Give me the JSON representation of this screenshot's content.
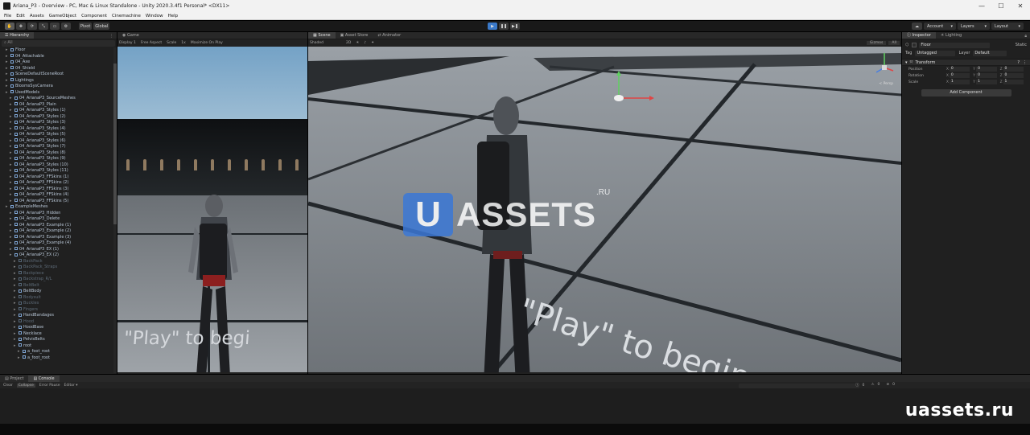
{
  "window": {
    "title": "Ariana_P3 - Overview - PC, Mac & Linux Standalone - Unity 2020.3.4f1 Personal* <DX11>",
    "controls": [
      "—",
      "☐",
      "✕"
    ]
  },
  "menu": [
    "File",
    "Edit",
    "Assets",
    "GameObject",
    "Component",
    "Cinemachine",
    "Window",
    "Help"
  ],
  "toolbar": {
    "tools": [
      "✋",
      "✥",
      "⟳",
      "⤡",
      "▭",
      "⚙"
    ],
    "pivot": "Pivot",
    "global": "Global",
    "play": "▶",
    "pause": "❚❚",
    "step": "▶❚",
    "account": "Account",
    "layers": "Layers",
    "layout": "Layout"
  },
  "hierarchy": {
    "tab": "Hierarchy",
    "search_placeholder": "All",
    "items": [
      {
        "label": "Floor",
        "indent": 1,
        "dim": false
      },
      {
        "label": "04_Attachable",
        "indent": 1,
        "dim": false
      },
      {
        "label": "04_Axe",
        "indent": 1,
        "dim": false
      },
      {
        "label": "04_Shield",
        "indent": 1,
        "dim": false
      },
      {
        "label": "SceneDefaultSceneRoot",
        "indent": 1,
        "dim": false
      },
      {
        "label": "Lightings",
        "indent": 1,
        "dim": false
      },
      {
        "label": "BloomsSysCamera",
        "indent": 1,
        "dim": false
      },
      {
        "label": "UsedModels",
        "indent": 1,
        "dim": false
      },
      {
        "label": "04_ArianaP3_SourceMeshes",
        "indent": 2,
        "dim": false
      },
      {
        "label": "04_ArianaP3_Plain",
        "indent": 2,
        "dim": false
      },
      {
        "label": "04_ArianaP3_Styles (1)",
        "indent": 2,
        "dim": false
      },
      {
        "label": "04_ArianaP3_Styles (2)",
        "indent": 2,
        "dim": false
      },
      {
        "label": "04_ArianaP3_Styles (3)",
        "indent": 2,
        "dim": false
      },
      {
        "label": "04_ArianaP3_Styles (4)",
        "indent": 2,
        "dim": false
      },
      {
        "label": "04_ArianaP3_Styles (5)",
        "indent": 2,
        "dim": false
      },
      {
        "label": "04_ArianaP3_Styles (6)",
        "indent": 2,
        "dim": false
      },
      {
        "label": "04_ArianaP3_Styles (7)",
        "indent": 2,
        "dim": false
      },
      {
        "label": "04_ArianaP3_Styles (8)",
        "indent": 2,
        "dim": false
      },
      {
        "label": "04_ArianaP3_Styles (9)",
        "indent": 2,
        "dim": false
      },
      {
        "label": "04_ArianaP3_Styles (10)",
        "indent": 2,
        "dim": false
      },
      {
        "label": "04_ArianaP3_Styles (11)",
        "indent": 2,
        "dim": false
      },
      {
        "label": "04_ArianaP3_FFSkins (1)",
        "indent": 2,
        "dim": false
      },
      {
        "label": "04_ArianaP3_FFSkins (2)",
        "indent": 2,
        "dim": false
      },
      {
        "label": "04_ArianaP3_FFSkins (3)",
        "indent": 2,
        "dim": false
      },
      {
        "label": "04_ArianaP3_FFSkins (4)",
        "indent": 2,
        "dim": false
      },
      {
        "label": "04_ArianaP3_FFSkins (5)",
        "indent": 2,
        "dim": false
      },
      {
        "label": "ExampleMeshes",
        "indent": 1,
        "dim": false
      },
      {
        "label": "04_ArianaP3_Hidden",
        "indent": 2,
        "dim": false
      },
      {
        "label": "04_ArianaP3_Delete",
        "indent": 2,
        "dim": false
      },
      {
        "label": "04_ArianaP3_Example (1)",
        "indent": 2,
        "dim": false
      },
      {
        "label": "04_ArianaP3_Example (2)",
        "indent": 2,
        "dim": false
      },
      {
        "label": "04_ArianaP3_Example (3)",
        "indent": 2,
        "dim": false
      },
      {
        "label": "04_ArianaP3_Example (4)",
        "indent": 2,
        "dim": false
      },
      {
        "label": "04_ArianaP3_EX (1)",
        "indent": 2,
        "dim": false
      },
      {
        "label": "04_ArianaP3_EX (2)",
        "indent": 2,
        "dim": false
      },
      {
        "label": "BackPack",
        "indent": 3,
        "dim": true
      },
      {
        "label": "BackPack_Straps",
        "indent": 3,
        "dim": true
      },
      {
        "label": "Backpiece",
        "indent": 3,
        "dim": true
      },
      {
        "label": "Backstrap_R/L",
        "indent": 3,
        "dim": true
      },
      {
        "label": "BeltBelt",
        "indent": 3,
        "dim": true
      },
      {
        "label": "BeltBody",
        "indent": 3,
        "dim": false
      },
      {
        "label": "Bodysuit",
        "indent": 3,
        "dim": true
      },
      {
        "label": "Buckles",
        "indent": 3,
        "dim": true
      },
      {
        "label": "Fingers",
        "indent": 3,
        "dim": true
      },
      {
        "label": "HandBandages",
        "indent": 3,
        "dim": false
      },
      {
        "label": "Hood",
        "indent": 3,
        "dim": true
      },
      {
        "label": "HoodBase",
        "indent": 3,
        "dim": false
      },
      {
        "label": "Necklace",
        "indent": 3,
        "dim": false
      },
      {
        "label": "PelvisBelts",
        "indent": 3,
        "dim": false
      },
      {
        "label": "root",
        "indent": 3,
        "dim": false
      },
      {
        "label": "a_foot_root",
        "indent": 4,
        "dim": false
      },
      {
        "label": "a_foot_root",
        "indent": 4,
        "dim": false
      }
    ]
  },
  "game_view": {
    "tab": "Game",
    "display": "Display 1",
    "aspect": "Free Aspect",
    "scale_label": "Scale",
    "scale_value": "1x",
    "maximize": "Maximize On Play",
    "overlay_text": "\"Play\" to begi"
  },
  "scene_view": {
    "tabs": [
      "Scene",
      "Asset Store",
      "Animator"
    ],
    "shading": "Shaded",
    "mode_2d": "2D",
    "gizmos": "Gizmos",
    "search_placeholder": "All",
    "persp_label": "< Persp",
    "overlay_text": "\"Play\" to begin",
    "watermark": {
      "letter": "U",
      "text": "ASSETS",
      "domain": ".RU"
    }
  },
  "inspector": {
    "tabs": [
      "Inspector",
      "Lighting"
    ],
    "object_name": "Floor",
    "static_label": "Static",
    "tag_label": "Tag",
    "tag_value": "Untagged",
    "layer_label": "Layer",
    "layer_value": "Default",
    "component": "Transform",
    "rows": [
      {
        "label": "Position",
        "x": "0",
        "y": "0",
        "z": "0"
      },
      {
        "label": "Rotation",
        "x": "0",
        "y": "0",
        "z": "0"
      },
      {
        "label": "Scale",
        "x": "1",
        "y": "1",
        "z": "1"
      }
    ],
    "add_component": "Add Component"
  },
  "console": {
    "tabs": [
      "Project",
      "Console"
    ],
    "buttons": [
      "Clear",
      "Collapse",
      "Error Pause",
      "Editor ▾"
    ],
    "counts": [
      "0",
      "0",
      "0"
    ]
  },
  "stamp": "uassets.ru",
  "colors": {
    "accent": "#3a79c9",
    "watermark_blue": "#3b78d6",
    "panel_bg": "#202020"
  }
}
